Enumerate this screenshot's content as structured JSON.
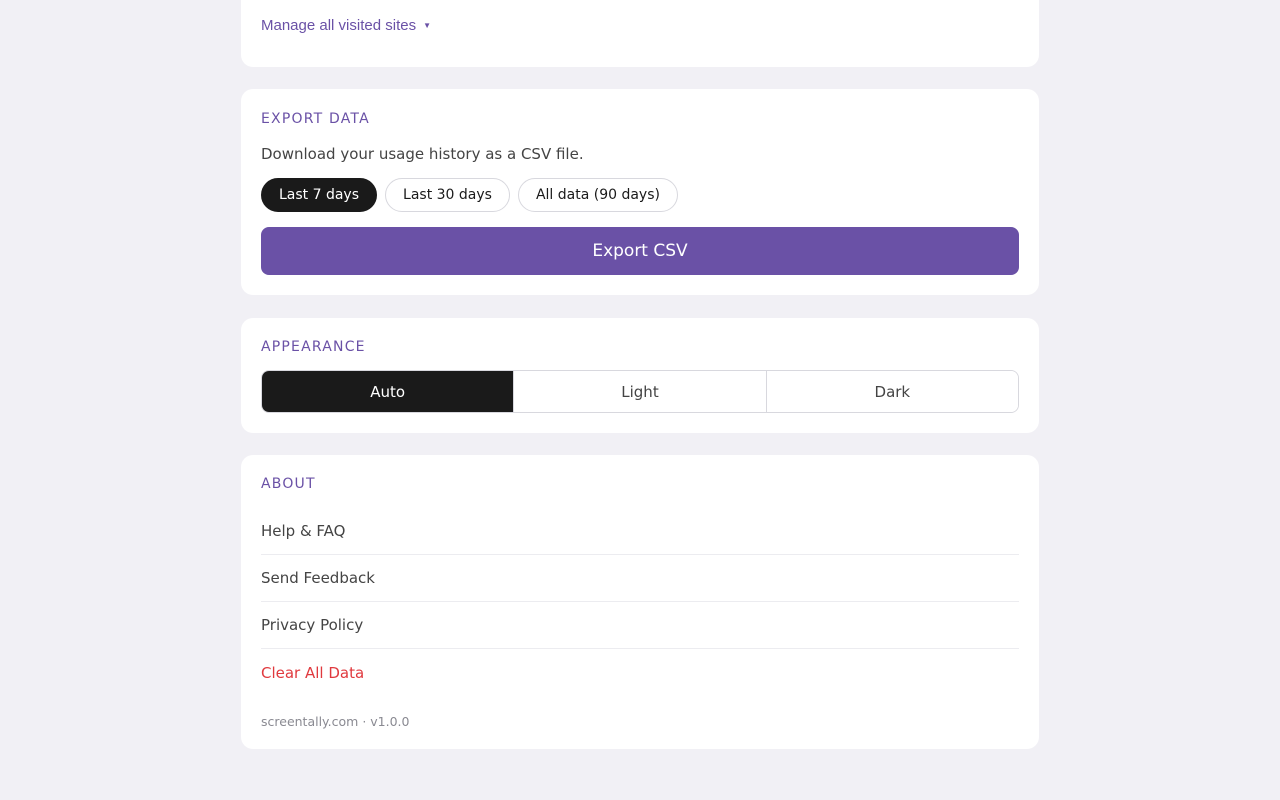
{
  "visited_sites": {
    "manage_label": "Manage all visited sites",
    "caret": "▼"
  },
  "export": {
    "title": "EXPORT DATA",
    "description": "Download your usage history as a CSV file.",
    "ranges": [
      {
        "label": "Last 7 days",
        "selected": true
      },
      {
        "label": "Last 30 days",
        "selected": false
      },
      {
        "label": "All data (90 days)",
        "selected": false
      }
    ],
    "button_label": "Export CSV"
  },
  "appearance": {
    "title": "APPEARANCE",
    "options": [
      {
        "label": "Auto",
        "selected": true
      },
      {
        "label": "Light",
        "selected": false
      },
      {
        "label": "Dark",
        "selected": false
      }
    ]
  },
  "about": {
    "title": "ABOUT",
    "items": [
      {
        "label": "Help & FAQ"
      },
      {
        "label": "Send Feedback"
      },
      {
        "label": "Privacy Policy"
      },
      {
        "label": "Clear All Data"
      }
    ],
    "footer": "screentally.com · v1.0.0"
  },
  "colors": {
    "background": "#f1f0f5",
    "accent": "#6a51a6",
    "selected": "#1a1a1a",
    "danger": "#e0393e"
  }
}
